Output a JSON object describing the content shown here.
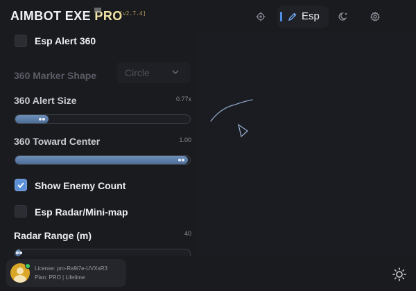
{
  "header": {
    "title_main": "AIMBOT EXE ",
    "title_accent": "PRO",
    "version": "[v2.7.4]",
    "tabs": [
      {
        "icon": "crosshair-icon"
      },
      {
        "icon": "pen-icon",
        "label": "Esp",
        "active": true
      },
      {
        "icon": "moon-icon"
      },
      {
        "icon": "gear-icon"
      }
    ]
  },
  "settings": {
    "esp_alert_360": {
      "label": "Esp Alert 360",
      "checked": false
    },
    "marker_shape": {
      "label": "360 Marker Shape",
      "value": "Circle",
      "disabled": true
    },
    "alert_size": {
      "label": "360  Alert Size",
      "value_text": "0.77x",
      "fraction": 0.19
    },
    "toward_center": {
      "label": "360 Toward Center",
      "value_text": "1.00",
      "fraction": 0.99
    },
    "show_enemy_count": {
      "label": "Show Enemy Count",
      "checked": true
    },
    "esp_radar": {
      "label": "Esp Radar/Mini-map",
      "checked": false
    },
    "radar_range": {
      "label": "Radar Range (m)",
      "value_text": "40",
      "fraction": 0.03
    }
  },
  "license": {
    "line1": "License: pro-Ra9i7e-UVXsR3",
    "line2": "Plan: PRO | Lifetime"
  },
  "colors": {
    "accent": "#4f8fe3",
    "title_accent": "#f3e6a6",
    "online": "#3ecf62"
  }
}
